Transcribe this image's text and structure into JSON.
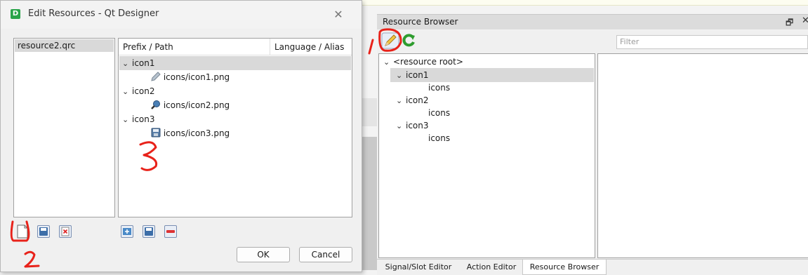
{
  "dialog": {
    "title": "Edit Resources - Qt Designer",
    "app_icon_letter": "D",
    "qrc_files": [
      "resource2.qrc"
    ],
    "columns": {
      "prefix": "Prefix / Path",
      "language": "Language / Alias"
    },
    "tree": [
      {
        "prefix": "icon1",
        "file": "icons/icon1.png",
        "file_icon": "pencil-icon"
      },
      {
        "prefix": "icon2",
        "file": "icons/icon2.png",
        "file_icon": "magnifier-icon"
      },
      {
        "prefix": "icon3",
        "file": "icons/icon3.png",
        "file_icon": "save-icon"
      }
    ],
    "ok_label": "OK",
    "cancel_label": "Cancel"
  },
  "browser": {
    "title": "Resource Browser",
    "filter_placeholder": "Filter",
    "root_label": "<resource root>",
    "tree": [
      {
        "label": "icon1",
        "child": "icons"
      },
      {
        "label": "icon2",
        "child": "icons"
      },
      {
        "label": "icon3",
        "child": "icons"
      }
    ]
  },
  "tabs": [
    "Signal/Slot Editor",
    "Action Editor",
    "Resource Browser"
  ],
  "annotations": [
    "1",
    "2",
    "3"
  ],
  "colors": {
    "annotation": "#e8221a",
    "selection": "#d9d9d9"
  }
}
